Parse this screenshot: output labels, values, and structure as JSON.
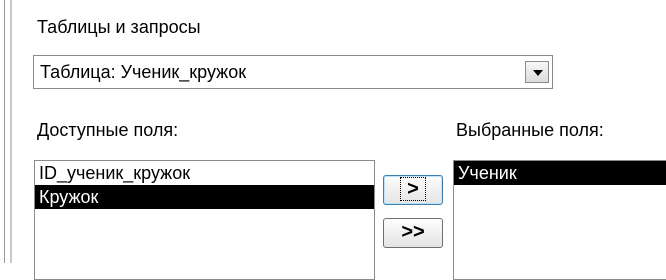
{
  "tables_label": "Таблицы и запросы",
  "table_select": {
    "value": "Таблица: Ученик_кружок"
  },
  "available_fields": {
    "label": "Доступные поля:",
    "items": [
      "ID_ученик_кружок",
      "Кружок"
    ],
    "selected_index": 1
  },
  "selected_fields": {
    "label": "Выбранные поля:",
    "items": [
      "Ученик"
    ],
    "selected_index": 0
  },
  "buttons": {
    "add_one": ">",
    "add_all": ">>"
  }
}
